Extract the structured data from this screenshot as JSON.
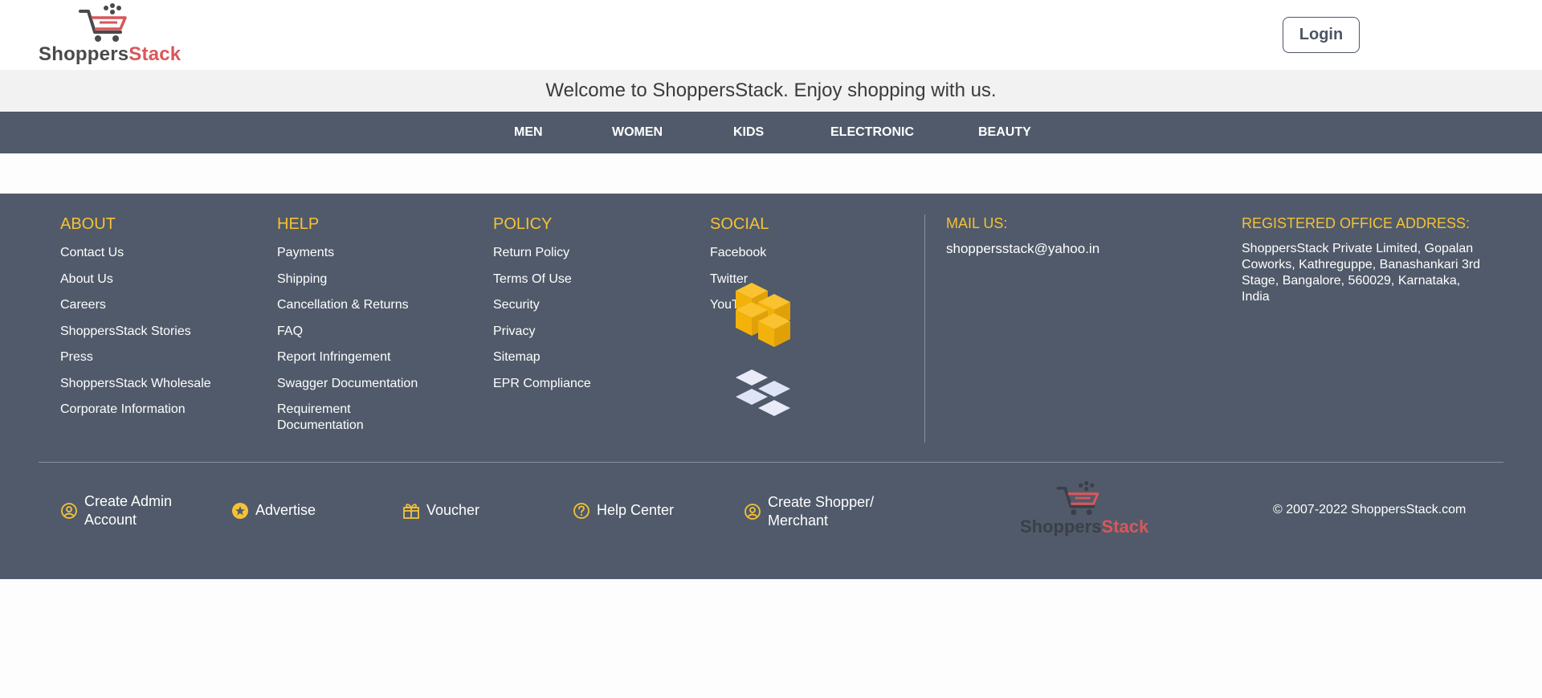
{
  "header": {
    "logo": {
      "text_main": "Shoppers",
      "text_accent": "Stack"
    },
    "login_label": "Login"
  },
  "welcome": {
    "text": "Welcome to ShoppersStack. Enjoy shopping with us."
  },
  "nav": {
    "items": [
      "MEN",
      "WOMEN",
      "KIDS",
      "ELECTRONIC",
      "BEAUTY"
    ]
  },
  "footer": {
    "about": {
      "title": "ABOUT",
      "links": [
        "Contact Us",
        "About Us",
        "Careers",
        "ShoppersStack Stories",
        "Press",
        "ShoppersStack Wholesale",
        "Corporate Information"
      ]
    },
    "help": {
      "title": "HELP",
      "links": [
        "Payments",
        "Shipping",
        "Cancellation & Returns",
        "FAQ",
        "Report Infringement",
        "Swagger Documentation",
        "Requirement Documentation"
      ]
    },
    "policy": {
      "title": "POLICY",
      "links": [
        "Return Policy",
        "Terms Of Use",
        "Security",
        "Privacy",
        "Sitemap",
        "EPR Compliance"
      ]
    },
    "social": {
      "title": "SOCIAL",
      "links": [
        "Facebook",
        "Twitter",
        "YouTube"
      ]
    },
    "mail": {
      "title": "MAIL US:",
      "value": "shoppersstack@yahoo.in"
    },
    "office": {
      "title": "REGISTERED OFFICE ADDRESS:",
      "value": "ShoppersStack Private Limited, Gopalan Coworks, Kathreguppe, Banashankari 3rd Stage, Bangalore, 560029, Karnataka, India"
    },
    "bottom": [
      {
        "label": "Create Admin Account",
        "icon": "user-circle-icon"
      },
      {
        "label": "Advertise",
        "icon": "star-icon"
      },
      {
        "label": "Voucher",
        "icon": "gift-icon"
      },
      {
        "label": "Help Center",
        "icon": "question-circle-icon"
      },
      {
        "label": "Create Shopper/ Merchant",
        "icon": "user-circle-icon"
      }
    ],
    "logo": {
      "text_main": "Shoppers",
      "text_accent": "Stack"
    },
    "copyright": "© 2007-2022 ShoppersStack.com"
  },
  "colors": {
    "accent": "#f5c235",
    "footer_bg": "#505a6a",
    "brand_red": "#d9575a"
  }
}
